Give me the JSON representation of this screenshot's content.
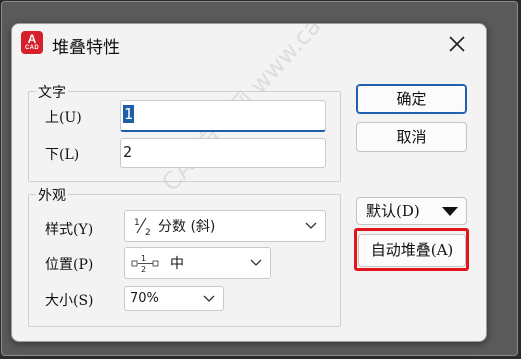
{
  "dialog": {
    "title": "堆叠特性",
    "icon_letter": "A",
    "icon_caption": "CAD",
    "close_icon": "close-icon"
  },
  "text_group": {
    "label": "文字",
    "upper_label": "上(U)",
    "upper_value": "1",
    "lower_label": "下(L)",
    "lower_value": "2"
  },
  "appearance_group": {
    "label": "外观",
    "style_label": "样式(Y)",
    "style_value": "分数 (斜)",
    "position_label": "位置(P)",
    "position_value": "中",
    "size_label": "大小(S)",
    "size_value": "70%"
  },
  "buttons": {
    "ok": "确定",
    "cancel": "取消",
    "default": "默认(D)",
    "autostack": "自动堆叠(A)"
  },
  "watermark": "CAD自学网 www.cadzxw.com",
  "colors": {
    "accent": "#1f5fa8",
    "highlight": "#e3141c",
    "icon_red": "#d6202b"
  }
}
